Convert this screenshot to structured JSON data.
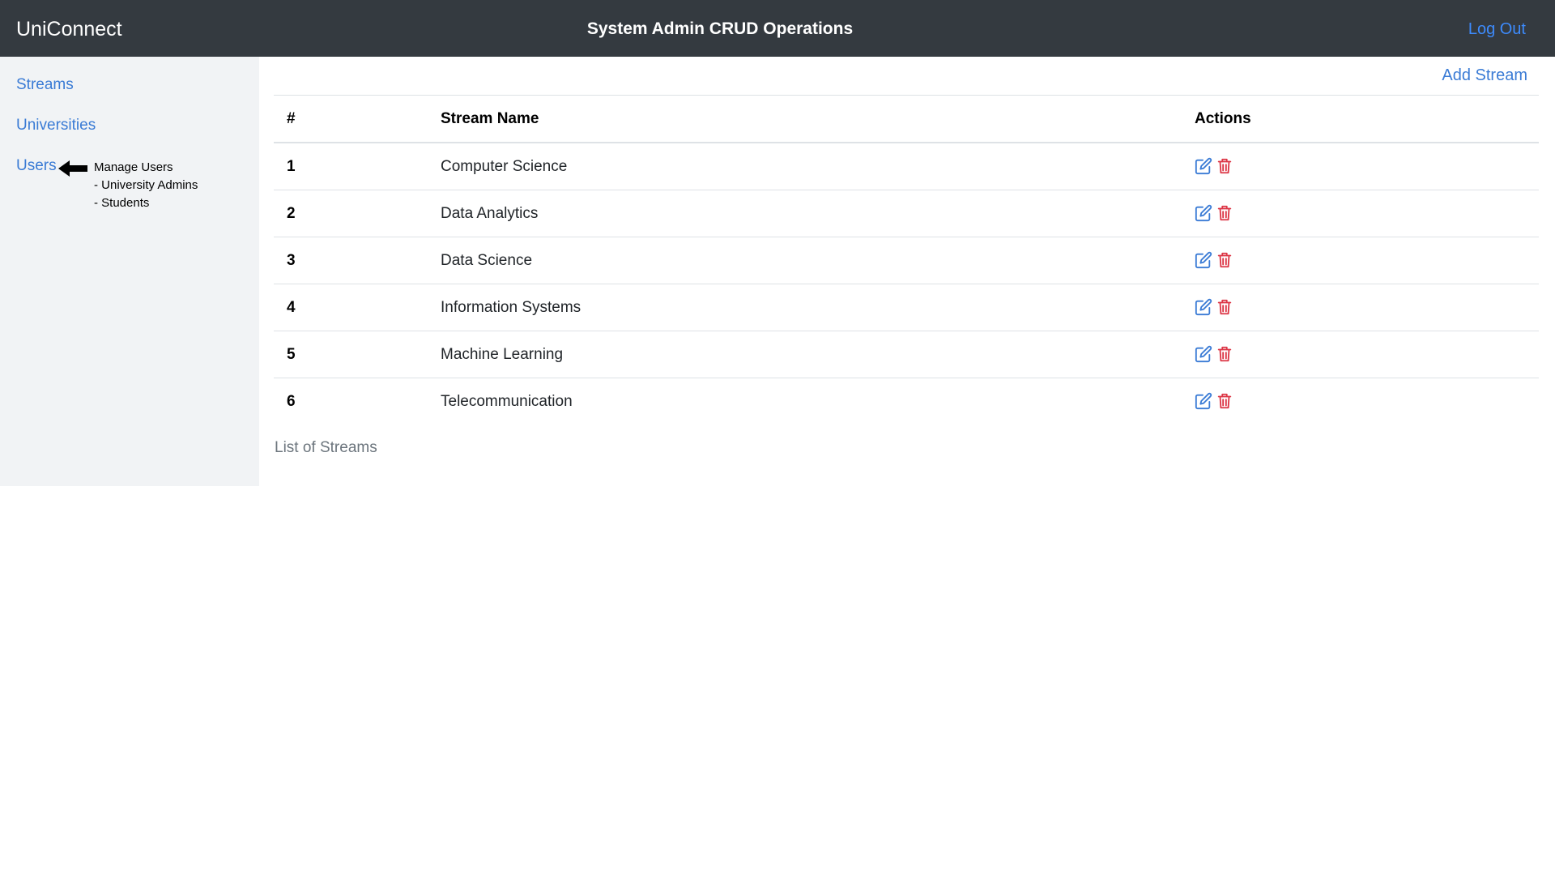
{
  "navbar": {
    "brand": "UniConnect",
    "title": "System Admin CRUD Operations",
    "logout_label": "Log Out"
  },
  "sidebar": {
    "items": [
      {
        "label": "Streams"
      },
      {
        "label": "Universities"
      },
      {
        "label": "Users"
      }
    ],
    "annotation": {
      "icon": "arrow-left-icon",
      "lines": [
        "Manage Users",
        "- University Admins",
        "- Students"
      ]
    }
  },
  "main": {
    "add_label": "Add Stream",
    "table": {
      "headers": [
        "#",
        "Stream Name",
        "Actions"
      ],
      "rows": [
        {
          "num": "1",
          "name": "Computer Science"
        },
        {
          "num": "2",
          "name": "Data Analytics"
        },
        {
          "num": "3",
          "name": "Data Science"
        },
        {
          "num": "4",
          "name": "Information Systems"
        },
        {
          "num": "5",
          "name": "Machine Learning"
        },
        {
          "num": "6",
          "name": "Telecommunication"
        }
      ],
      "row_actions": [
        "edit-icon",
        "trash-icon"
      ],
      "caption": "List of Streams"
    }
  },
  "colors": {
    "navbar_bg": "#343a40",
    "link": "#3a7bd5",
    "edit_icon": "#3a7bd5",
    "delete_icon": "#dc3545",
    "sidebar_bg": "#f1f3f5"
  }
}
